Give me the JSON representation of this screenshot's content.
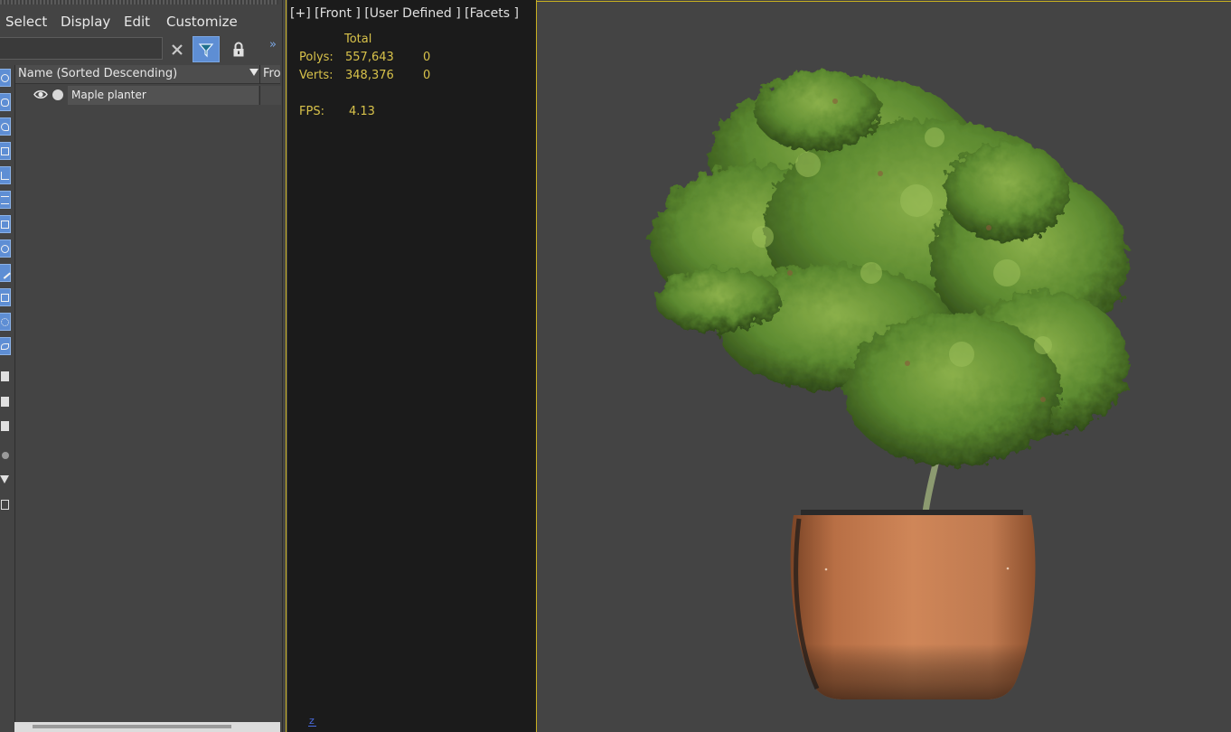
{
  "menu": {
    "items": [
      "Select",
      "Display",
      "Edit",
      "Customize"
    ]
  },
  "explorer": {
    "search_value": "",
    "clear_icon": "close-icon",
    "filter_icon": "filter-icon",
    "lock_icon": "lock-icon",
    "expand_glyph": "»",
    "columns": {
      "name": "Name (Sorted Descending)",
      "frozen": "Fro:"
    },
    "rows": [
      {
        "label": "Maple planter",
        "visible": true,
        "renderable": true
      }
    ],
    "toolbar_icons": [
      "geometry-icon",
      "shape-icon",
      "light-icon",
      "camera-icon",
      "helper-icon",
      "spacewarp-icon",
      "group-icon",
      "xref-icon",
      "bone-icon",
      "container-icon",
      "frozen-icon",
      "hidden-icon",
      "display-all-icon",
      "display-none-icon",
      "invert-display-icon",
      "settings-icon",
      "filter-icon",
      "layer-icon"
    ]
  },
  "viewport": {
    "label": "[+] [Front ] [User Defined ] [Facets ]",
    "stats": {
      "header": "Total",
      "polys_label": "Polys:",
      "polys_total": "557,643",
      "polys_selected": "0",
      "verts_label": "Verts:",
      "verts_total": "348,376",
      "verts_selected": "0",
      "fps_label": "FPS:",
      "fps_value": "4.13"
    },
    "axis_label": "z",
    "colors": {
      "active_border": "#c8b020",
      "stats_text": "#d8c24a",
      "pot": "#c07a50",
      "foliage": "#5c8a30"
    }
  }
}
